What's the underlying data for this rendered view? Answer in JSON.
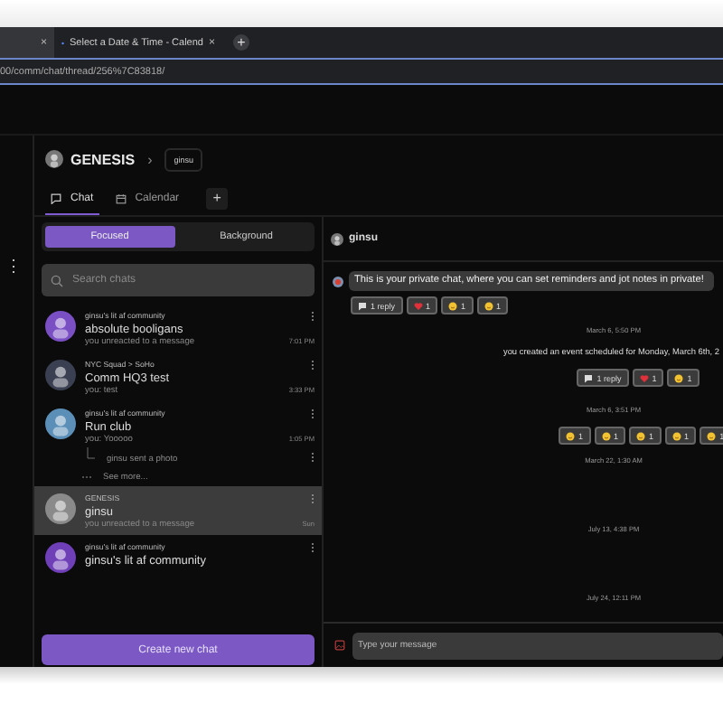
{
  "browser": {
    "tabs": [
      {
        "selected": false,
        "close": "×"
      },
      {
        "title": "Select a Date & Time - Calend",
        "selected": true,
        "close": "×"
      }
    ],
    "new_tab": "+",
    "url": "00/comm/chat/thread/256%7C83818/"
  },
  "rail": {
    "menu": "⋮"
  },
  "header": {
    "community": "GENESIS",
    "separator": "›",
    "channel": "ginsu"
  },
  "tabs": [
    {
      "label": "Chat",
      "kind": "chat",
      "selected": true
    },
    {
      "label": "Calendar",
      "kind": "calendar",
      "selected": false
    }
  ],
  "add_tab": "+",
  "sidebar": {
    "segments": [
      {
        "label": "Focused",
        "selected": true
      },
      {
        "label": "Background",
        "selected": false
      }
    ],
    "search": {
      "placeholder": "Search chats"
    },
    "chats": [
      {
        "community": "ginsu's lit af community",
        "name": "absolute booligans",
        "preview": "you unreacted to a message",
        "time": "7:01 PM",
        "selected": false,
        "color": "#7a4fc4"
      },
      {
        "community": "NYC Squad > SoHo",
        "name": "Comm HQ3 test",
        "preview": "you: test",
        "time": "3:33 PM",
        "selected": false,
        "color": "#3a3f52"
      },
      {
        "community": "ginsu's lit af community",
        "name": "Run club",
        "preview": "you: Yooooo",
        "time": "1:05 PM",
        "selected": false,
        "color": "#5b8fb8",
        "thread": "ginsu sent a photo",
        "see_more": "See more..."
      },
      {
        "community": "GENESIS",
        "name": "ginsu",
        "preview": "you unreacted to a message",
        "time": "Sun",
        "selected": true,
        "color": "#8a8a8a"
      },
      {
        "community": "ginsu's lit af community",
        "name": "ginsu's lit af community",
        "selected": false,
        "color": "#6f3fb8"
      }
    ],
    "create_button": "Create new chat"
  },
  "chat": {
    "title": "ginsu",
    "messages": [
      {
        "kind": "bubble",
        "text": "This is your private chat, where you can set reminders and jot notes in private!"
      },
      {
        "kind": "reactions",
        "items": [
          {
            "kind": "reply",
            "count": "1 reply"
          },
          {
            "kind": "heart",
            "count": "1"
          },
          {
            "kind": "emoji",
            "count": "1"
          },
          {
            "kind": "emoji",
            "count": "1"
          }
        ]
      },
      {
        "kind": "timestamp",
        "text": "March 6, 5:50 PM"
      },
      {
        "kind": "event",
        "text": "you created an event scheduled for Monday, March 6th, 2"
      },
      {
        "kind": "reactions",
        "items": [
          {
            "kind": "reply",
            "count": "1 reply"
          },
          {
            "kind": "heart",
            "count": "1"
          },
          {
            "kind": "emoji",
            "count": "1"
          }
        ]
      },
      {
        "kind": "timestamp",
        "text": "March 6, 3:51 PM"
      },
      {
        "kind": "reactions",
        "items": [
          {
            "kind": "emoji",
            "count": "1"
          },
          {
            "kind": "emoji",
            "count": "1"
          },
          {
            "kind": "emoji",
            "count": "1"
          },
          {
            "kind": "emoji",
            "count": "1"
          },
          {
            "kind": "emoji",
            "count": "1"
          }
        ]
      },
      {
        "kind": "timestamp",
        "text": "March 22, 1:30 AM"
      },
      {
        "kind": "spacer"
      },
      {
        "kind": "timestamp",
        "text": "July 13, 4:38 PM"
      },
      {
        "kind": "spacer"
      },
      {
        "kind": "timestamp",
        "text": "July 24, 12:11 PM"
      }
    ],
    "composer": {
      "placeholder": "Type your message"
    }
  }
}
